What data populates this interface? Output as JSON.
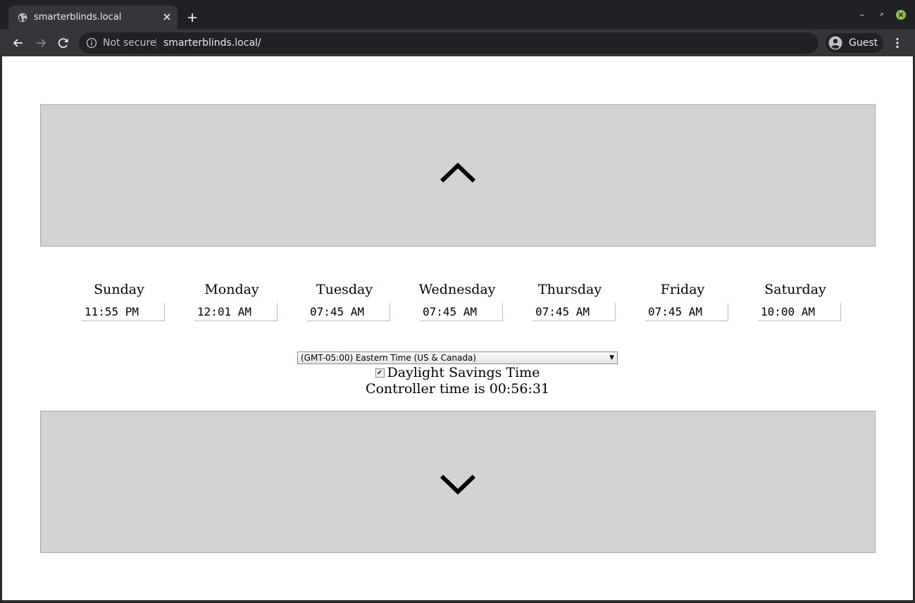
{
  "browser": {
    "tab_title": "smarterblinds.local",
    "security_label": "Not secure",
    "url": "smarterblinds.local/",
    "profile_label": "Guest"
  },
  "page": {
    "schedule": [
      {
        "day": "Sunday",
        "time": "11:55 PM"
      },
      {
        "day": "Monday",
        "time": "12:01 AM"
      },
      {
        "day": "Tuesday",
        "time": "07:45 AM"
      },
      {
        "day": "Wednesday",
        "time": "07:45 AM"
      },
      {
        "day": "Thursday",
        "time": "07:45 AM"
      },
      {
        "day": "Friday",
        "time": "07:45 AM"
      },
      {
        "day": "Saturday",
        "time": "10:00 AM"
      }
    ],
    "timezone_selected": "(GMT-05:00) Eastern Time (US & Canada)",
    "dst_label": "Daylight Savings Time",
    "dst_checked": true,
    "controller_time_text": "Controller time is 00:56:31"
  },
  "icons": {
    "up_button": "chevron-up-icon",
    "down_button": "chevron-down-icon"
  },
  "colors": {
    "button_bg": "#d3d3d3",
    "button_border": "#a9a9a9",
    "chrome_bg": "#202124",
    "toolbar_bg": "#35363a"
  }
}
